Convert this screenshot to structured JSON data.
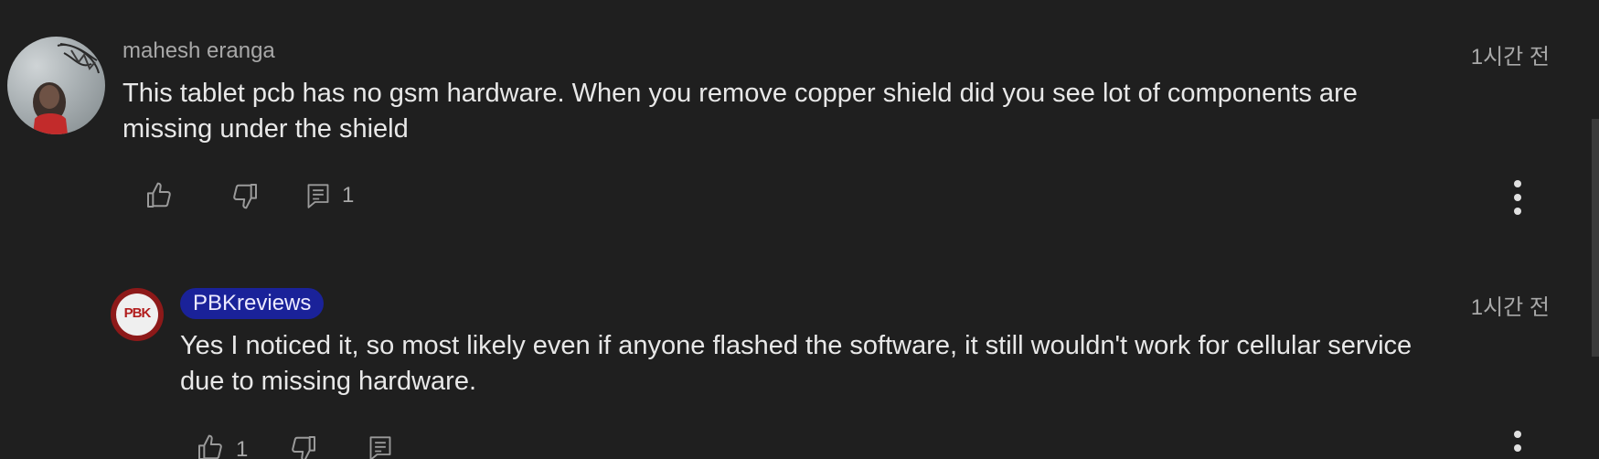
{
  "comment": {
    "author": "mahesh eranga",
    "time": "1시간 전",
    "text_line1": "This tablet pcb has no gsm hardware. When you remove copper shield did you see lot of components are",
    "text_line2": "missing under the shield",
    "like_icon": "thumbs-up-icon",
    "dislike_icon": "thumbs-down-icon",
    "reply_icon": "reply-comment-icon",
    "reply_count": "1",
    "menu_icon": "more-vert-icon"
  },
  "reply": {
    "author": "PBKreviews",
    "avatar_text": "PBK",
    "time": "1시간 전",
    "text_line1": "Yes I noticed it, so most likely even if anyone flashed the software, it still wouldn't work for cellular service",
    "text_line2": "due to missing hardware.",
    "like_count": "1",
    "like_icon": "thumbs-up-icon",
    "dislike_icon": "thumbs-down-icon",
    "reply_icon": "reply-comment-icon",
    "menu_icon": "more-vert-icon"
  },
  "colors": {
    "background": "#1f1f1f",
    "text_primary": "#e8e8e8",
    "text_secondary": "#a8a8a8",
    "creator_badge": "#1a2299",
    "pbk_avatar_ring": "#8d1919"
  }
}
